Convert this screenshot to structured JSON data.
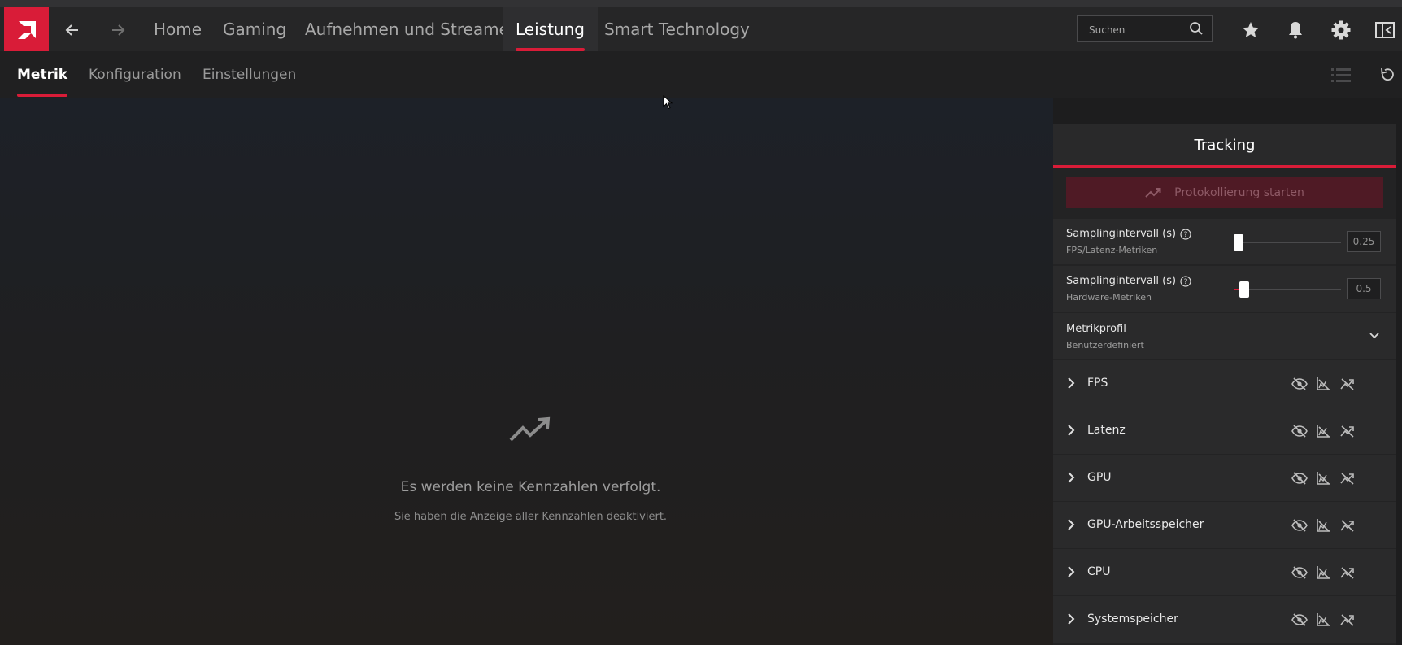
{
  "topbar": {
    "tabs": [
      {
        "label": "Home"
      },
      {
        "label": "Gaming"
      },
      {
        "label": "Aufnehmen und Streamen"
      },
      {
        "label": "Leistung",
        "active": true
      },
      {
        "label": "Smart Technology"
      }
    ],
    "search_placeholder": "Suchen"
  },
  "subnav": {
    "tabs": [
      {
        "label": "Metrik",
        "active": true
      },
      {
        "label": "Konfiguration"
      },
      {
        "label": "Einstellungen"
      }
    ]
  },
  "empty_state": {
    "title": "Es werden keine Kennzahlen verfolgt.",
    "subtitle": "Sie haben die Anzeige aller Kennzahlen deaktiviert."
  },
  "tracking": {
    "title": "Tracking",
    "log_button": "Protokollierung starten",
    "sampling_fps": {
      "title": "Samplingintervall (s)",
      "subtitle": "FPS/Latenz-Metriken",
      "value": "0.25",
      "slider_fraction": 0.0
    },
    "sampling_hw": {
      "title": "Samplingintervall (s)",
      "subtitle": "Hardware-Metriken",
      "value": "0.5",
      "slider_fraction": 0.06
    },
    "profile": {
      "title": "Metrikprofil",
      "subtitle": "Benutzerdefiniert"
    },
    "metrics": [
      "FPS",
      "Latenz",
      "GPU",
      "GPU-Arbeitsspeicher",
      "CPU",
      "Systemspeicher"
    ]
  },
  "colors": {
    "accent": "#d91c38"
  }
}
